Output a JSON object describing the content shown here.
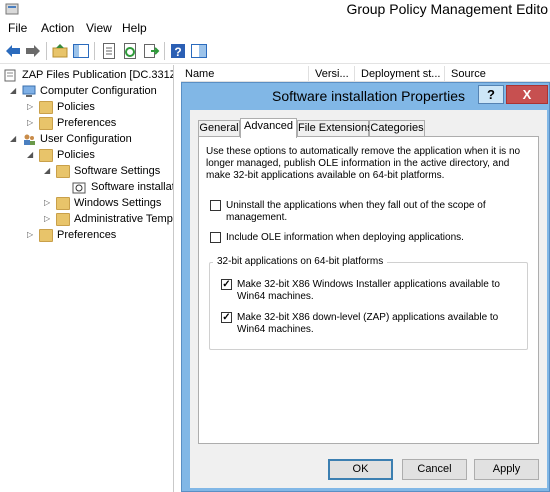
{
  "window": {
    "title": "Group Policy Management Edito"
  },
  "menu": [
    "File",
    "Action",
    "View",
    "Help"
  ],
  "toolbar": {
    "icons": [
      "back-arrow-icon",
      "forward-arrow-icon",
      "up-folder-icon",
      "show-hide-tree-icon",
      "properties-icon",
      "refresh-icon",
      "export-list-icon",
      "help-icon",
      "console-view-icon"
    ]
  },
  "tree": {
    "items": [
      {
        "label": "ZAP Files Publication [DC.331Z",
        "icon": "gpo-scroll-icon",
        "expand": ""
      },
      {
        "label": "Computer Configuration",
        "icon": "computer-icon",
        "expand": "open"
      },
      {
        "label": "Policies",
        "icon": "folder-icon",
        "expand": "closed"
      },
      {
        "label": "Preferences",
        "icon": "folder-icon",
        "expand": "closed"
      },
      {
        "label": "User Configuration",
        "icon": "users-icon",
        "expand": "open"
      },
      {
        "label": "Policies",
        "icon": "folder-icon",
        "expand": "open"
      },
      {
        "label": "Software Settings",
        "icon": "folder-icon",
        "expand": "open"
      },
      {
        "label": "Software installat",
        "icon": "software-install-icon",
        "expand": ""
      },
      {
        "label": "Windows Settings",
        "icon": "folder-icon",
        "expand": "closed"
      },
      {
        "label": "Administrative Temp",
        "icon": "folder-icon",
        "expand": "closed"
      },
      {
        "label": "Preferences",
        "icon": "folder-icon",
        "expand": "closed"
      }
    ]
  },
  "list": {
    "columns": [
      "Name",
      "Versi...",
      "Deployment st...",
      "Source"
    ]
  },
  "dialog": {
    "title": "Software installation Properties",
    "help_glyph": "?",
    "close_glyph": "X",
    "tabs": [
      "General",
      "Advanced",
      "File Extensions",
      "Categories"
    ],
    "active_tab": "Advanced",
    "description": "Use these options to automatically remove the application when it is no longer managed, publish OLE information in the active directory, and make 32-bit applications available on 64-bit platforms.",
    "options": {
      "uninstall": {
        "label": "Uninstall the applications when they fall out of the scope of management.",
        "checked": false
      },
      "ole": {
        "label": "Include OLE information when deploying applications.",
        "checked": false
      }
    },
    "group": {
      "title": "32-bit applications on 64-bit platforms",
      "x86_installer": {
        "label": "Make 32-bit X86 Windows Installer applications available to Win64 machines.",
        "checked": true
      },
      "x86_zap": {
        "label": "Make 32-bit X86 down-level (ZAP) applications available to Win64 machines.",
        "checked": true
      }
    },
    "buttons": {
      "ok": "OK",
      "cancel": "Cancel",
      "apply": "Apply"
    }
  }
}
